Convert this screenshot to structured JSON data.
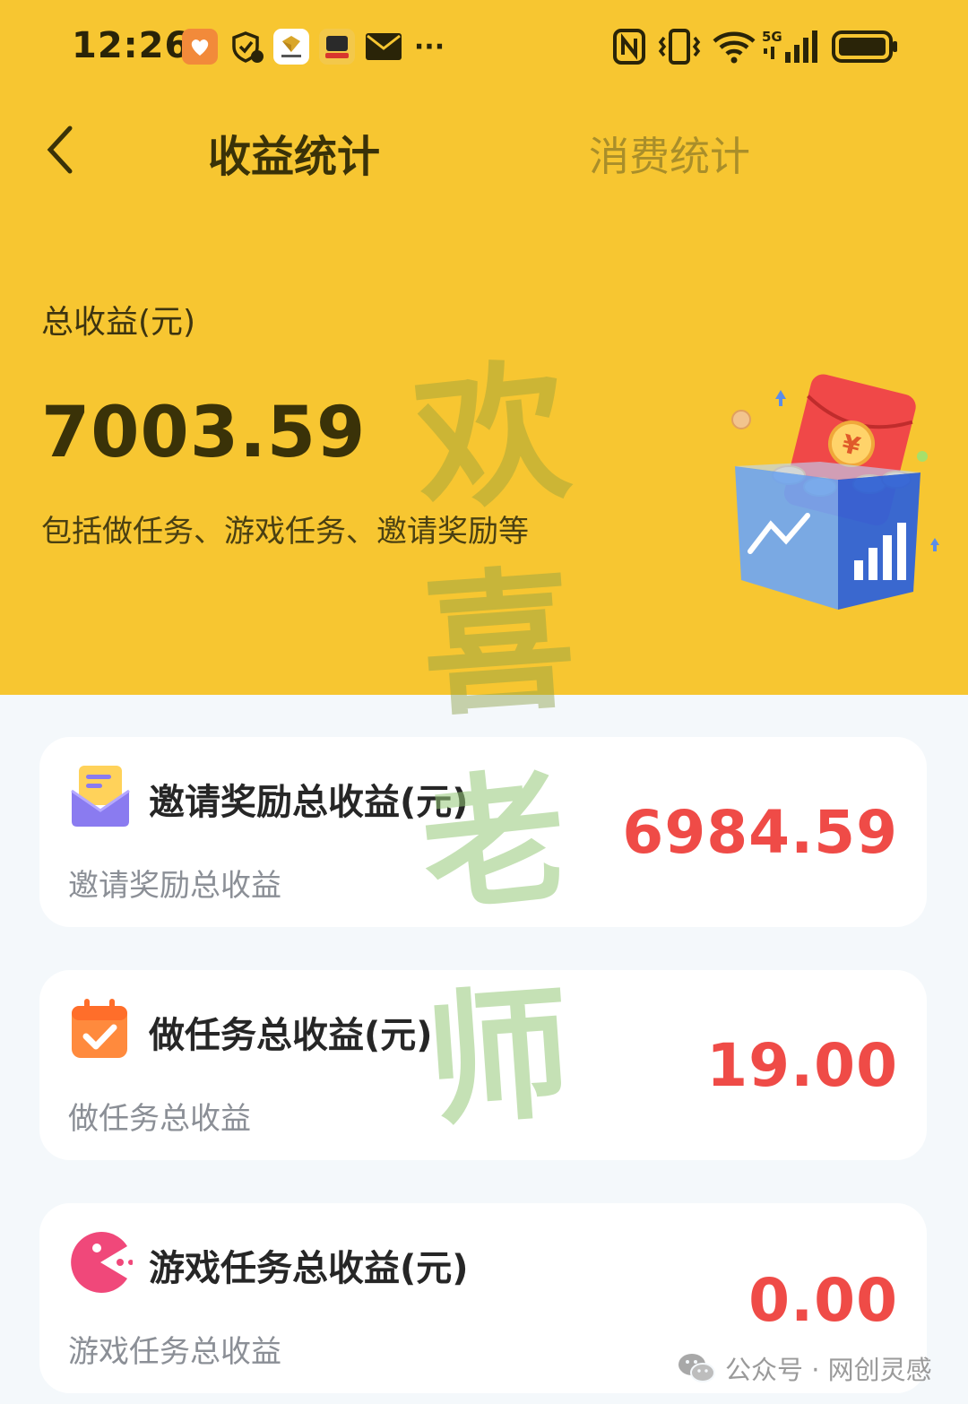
{
  "status_bar": {
    "time": "12:26",
    "more": "···",
    "network": "5G",
    "icons": [
      "app-notification-icon",
      "shield-icon",
      "honor-app-icon",
      "qu-app-icon",
      "mail-icon",
      "nfc-icon",
      "vibrate-icon",
      "wifi-icon",
      "signal-icon",
      "battery-icon"
    ]
  },
  "nav": {
    "back_icon": "chevron-left-icon",
    "tabs": [
      {
        "label": "收益统计",
        "active": true
      },
      {
        "label": "消费统计",
        "active": false
      }
    ]
  },
  "summary": {
    "label": "总收益(元)",
    "value": "7003.59",
    "description": "包括做任务、游戏任务、邀请奖励等",
    "illustration": "red-envelope-coin-box-illustration"
  },
  "watermark_chars": [
    "欢",
    "喜",
    "老",
    "师"
  ],
  "cards": [
    {
      "icon": "mail-icon",
      "title": "邀请奖励总收益(元)",
      "subtitle": "邀请奖励总收益",
      "value": "6984.59"
    },
    {
      "icon": "calendar-check-icon",
      "title": "做任务总收益(元)",
      "subtitle": "做任务总收益",
      "value": "19.00"
    },
    {
      "icon": "game-pacman-icon",
      "title": "游戏任务总收益(元)",
      "subtitle": "游戏任务总收益",
      "value": "0.00"
    }
  ],
  "footer": {
    "icon": "wechat-icon",
    "text": "公众号 · 网创灵感"
  },
  "colors": {
    "header_bg": "#f7c631",
    "page_bg": "#f4f8fb",
    "card_bg": "#ffffff",
    "value_red": "#ef4b47",
    "title_dark": "#3a3208",
    "inactive_tab": "#a98e2a"
  }
}
